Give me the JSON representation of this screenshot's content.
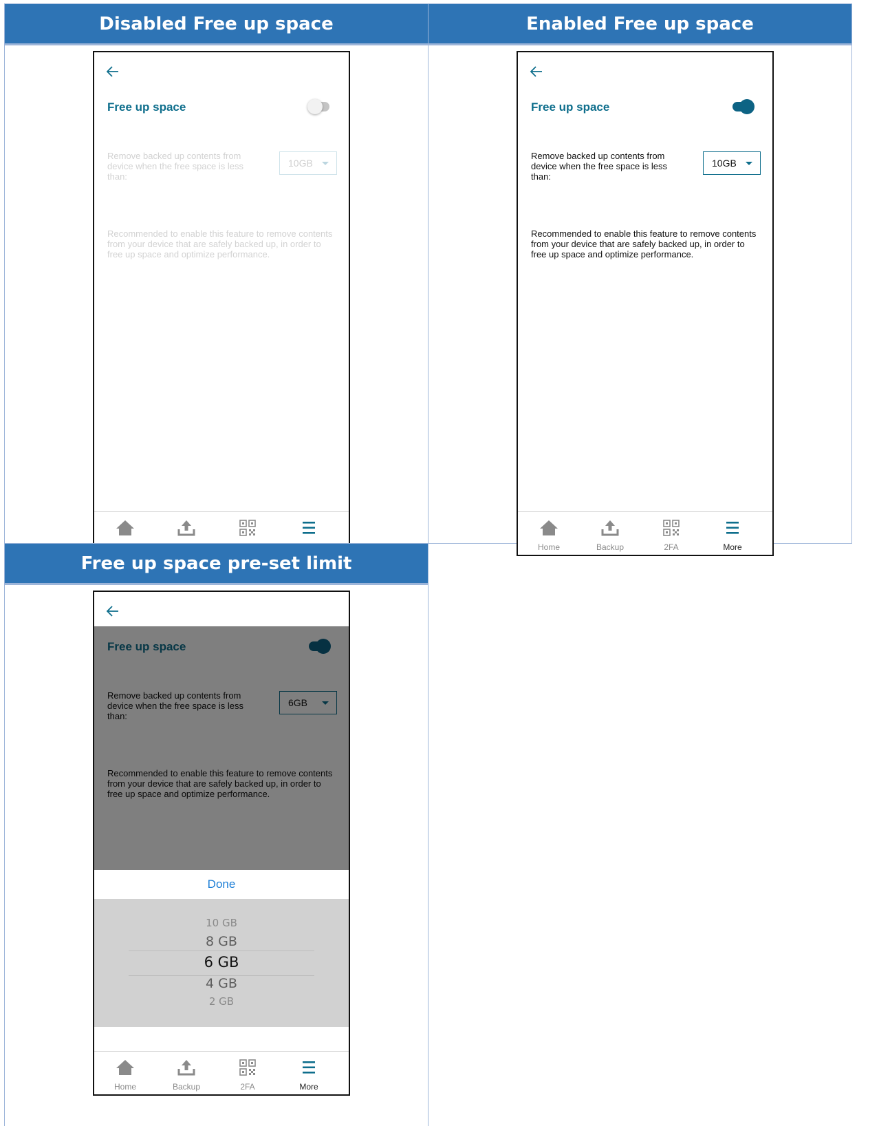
{
  "panels": {
    "disabled": {
      "header": "Disabled Free up space"
    },
    "enabled": {
      "header": "Enabled Free up space"
    },
    "preset": {
      "header": "Free up space pre-set limit"
    }
  },
  "screen": {
    "title": "Free up space",
    "description": "Remove backed up contents from device when the free space is less than:",
    "note": "Recommended to enable this feature to remove contents from your device that are safely backed up, in order to free up space and optimize performance."
  },
  "values": {
    "disabled_limit": "10GB",
    "enabled_limit": "10GB",
    "preset_limit": "6GB"
  },
  "toggles": {
    "disabled": false,
    "enabled": true,
    "preset": true
  },
  "nav": {
    "home": "Home",
    "backup": "Backup",
    "twofa": "2FA",
    "more": "More",
    "active": "More"
  },
  "picker": {
    "done": "Done",
    "options": [
      "10 GB",
      "8 GB",
      "6 GB",
      "4 GB",
      "2 GB"
    ],
    "selected": "6 GB"
  },
  "colors": {
    "header_bg": "#2e74b5",
    "accent": "#0e6e8c",
    "toggle_on": "#0d6384",
    "done": "#1c7ed6"
  },
  "icons": {
    "back": "back-arrow-icon",
    "home": "home-icon",
    "backup": "upload-icon",
    "twofa": "qr-code-icon",
    "more": "menu-icon"
  }
}
